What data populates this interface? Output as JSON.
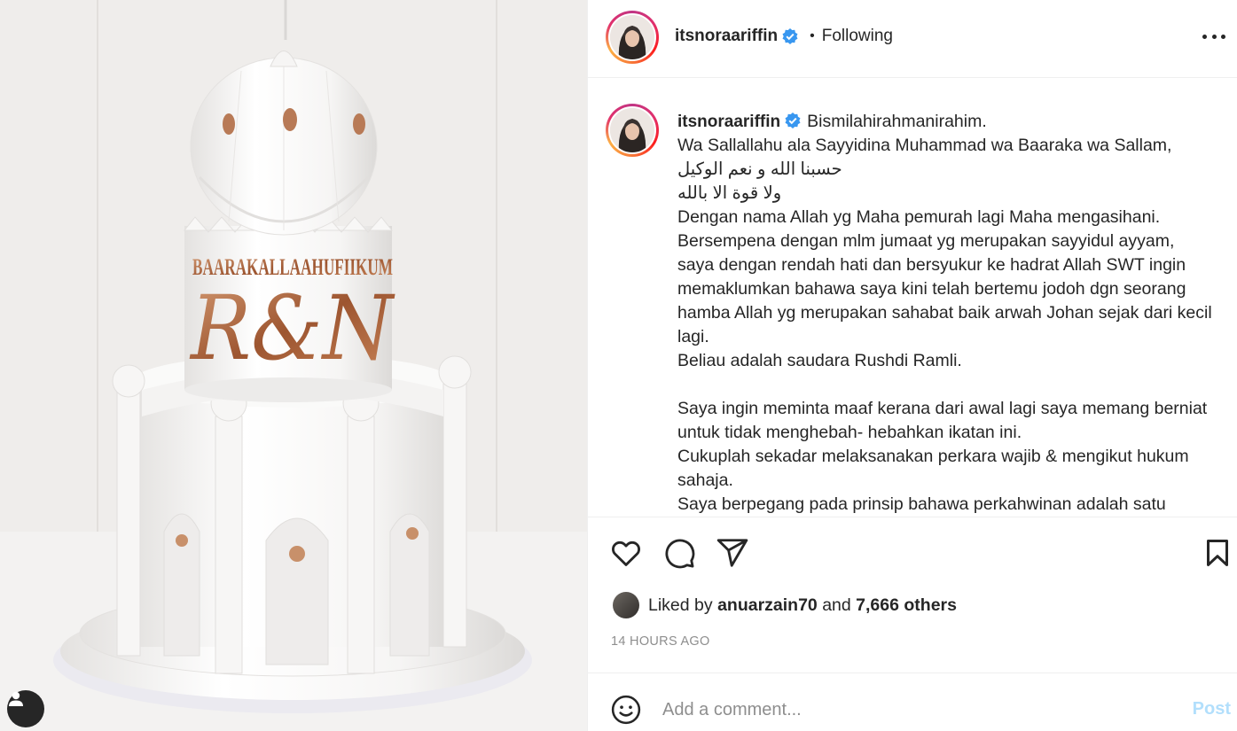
{
  "post": {
    "username": "itsnoraariffin",
    "separator": "•",
    "follow_status": "Following",
    "caption": "Bismilahirahmanirahim.\nWa Sallallahu ala Sayyidina Muhammad wa Baaraka wa Sallam,\nحسبنا الله و نعم الوكيل\nولا قوة الا بالله\nDengan nama Allah yg Maha pemurah lagi Maha mengasihani.\nBersempena dengan mlm jumaat yg merupakan sayyidul ayyam,\nsaya dengan rendah hati dan bersyukur ke hadrat Allah SWT ingin memaklumkan bahawa saya kini telah bertemu jodoh dgn seorang hamba Allah yg merupakan sahabat baik arwah Johan sejak dari kecil lagi.\nBeliau adalah saudara Rushdi Ramli.\n\nSaya ingin meminta maaf kerana dari awal lagi saya memang berniat untuk tidak menghebah- hebahkan ikatan ini.\nCukuplah sekadar melaksanakan perkara wajib & mengikut hukum sahaja.\nSaya berpegang pada prinsip bahawa perkahwinan adalah satu",
    "image_text": {
      "line1": "BAARAKALLAAHUFIIKUM",
      "line2": "R&N"
    }
  },
  "likes": {
    "prefix": "Liked by",
    "user": "anuarzain70",
    "joiner": "and",
    "others": "7,666 others"
  },
  "timestamp": "14 HOURS AGO",
  "comment": {
    "placeholder": "Add a comment...",
    "post_label": "Post"
  },
  "colors": {
    "text": "#262626",
    "secondary": "#8e8e8e",
    "verified": "#3897f0",
    "post_disabled": "#b2dffc",
    "rose_gold": "#b86b45"
  },
  "icons": [
    "verified-badge-icon",
    "more-options-icon",
    "heart-icon",
    "comment-icon",
    "share-icon",
    "bookmark-icon",
    "emoji-icon",
    "user-tag-icon"
  ]
}
